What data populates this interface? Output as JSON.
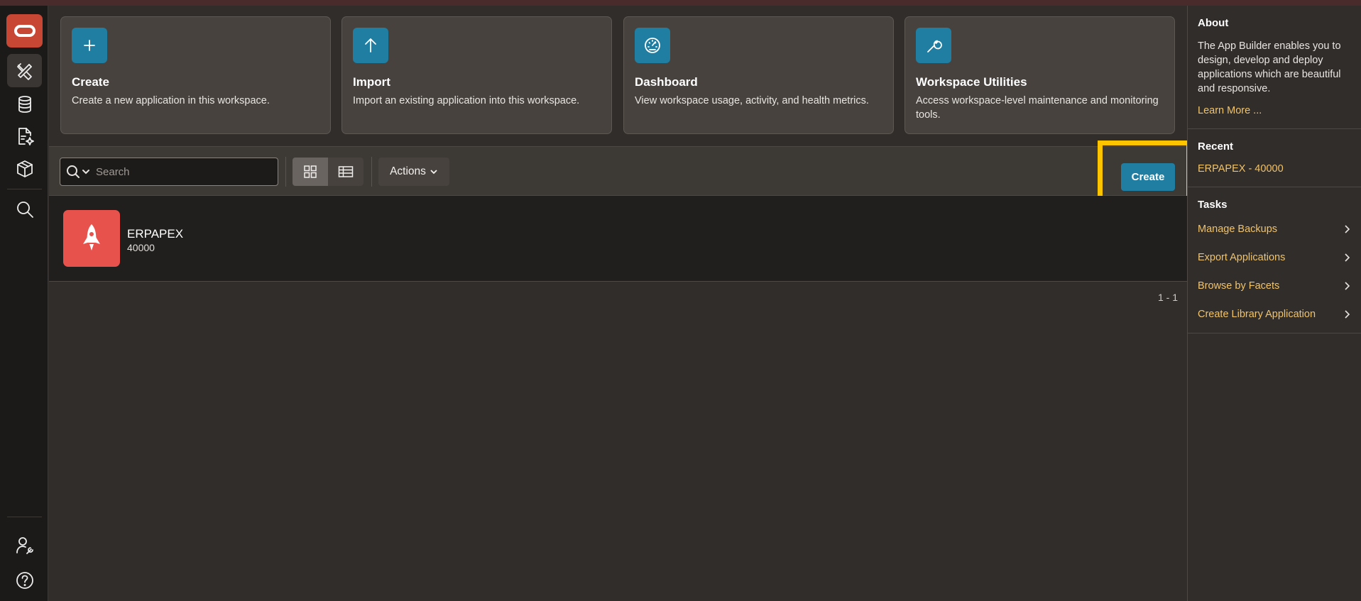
{
  "nav": {
    "items": [
      {
        "name": "app-builder",
        "icon": "pencil-ruler-icon"
      },
      {
        "name": "sql-workshop",
        "icon": "database-icon"
      },
      {
        "name": "gallery",
        "icon": "document-sparkle-icon"
      },
      {
        "name": "packages",
        "icon": "cube-icon"
      },
      {
        "name": "search",
        "icon": "search-icon"
      },
      {
        "name": "administration",
        "icon": "user-wrench-icon"
      },
      {
        "name": "help",
        "icon": "help-icon"
      }
    ]
  },
  "cards": [
    {
      "title": "Create",
      "description": "Create a new application in this workspace.",
      "icon": "plus-icon"
    },
    {
      "title": "Import",
      "description": "Import an existing application into this workspace.",
      "icon": "arrow-up-icon"
    },
    {
      "title": "Dashboard",
      "description": "View workspace usage, activity, and health metrics.",
      "icon": "gauge-icon"
    },
    {
      "title": "Workspace Utilities",
      "description": "Access workspace-level maintenance and monitoring tools.",
      "icon": "wrench-icon"
    }
  ],
  "toolbar": {
    "search_placeholder": "Search",
    "actions_label": "Actions",
    "create_label": "Create"
  },
  "apps": [
    {
      "name": "ERPAPEX",
      "id": "40000",
      "color": "#e8524d"
    }
  ],
  "pagination": "1 - 1",
  "sidebar": {
    "about_title": "About",
    "about_text": "The App Builder enables you to design, develop and deploy applications which are beautiful and responsive.",
    "learn_more": "Learn More ...",
    "recent_title": "Recent",
    "recent_items": [
      "ERPAPEX - 40000"
    ],
    "tasks_title": "Tasks",
    "tasks": [
      "Manage Backups",
      "Export Applications",
      "Browse by Facets",
      "Create Library Application"
    ]
  },
  "colors": {
    "accent": "#1f7ea1",
    "highlight": "#ffc400",
    "link": "#f0c36b",
    "brand": "#c74634"
  }
}
